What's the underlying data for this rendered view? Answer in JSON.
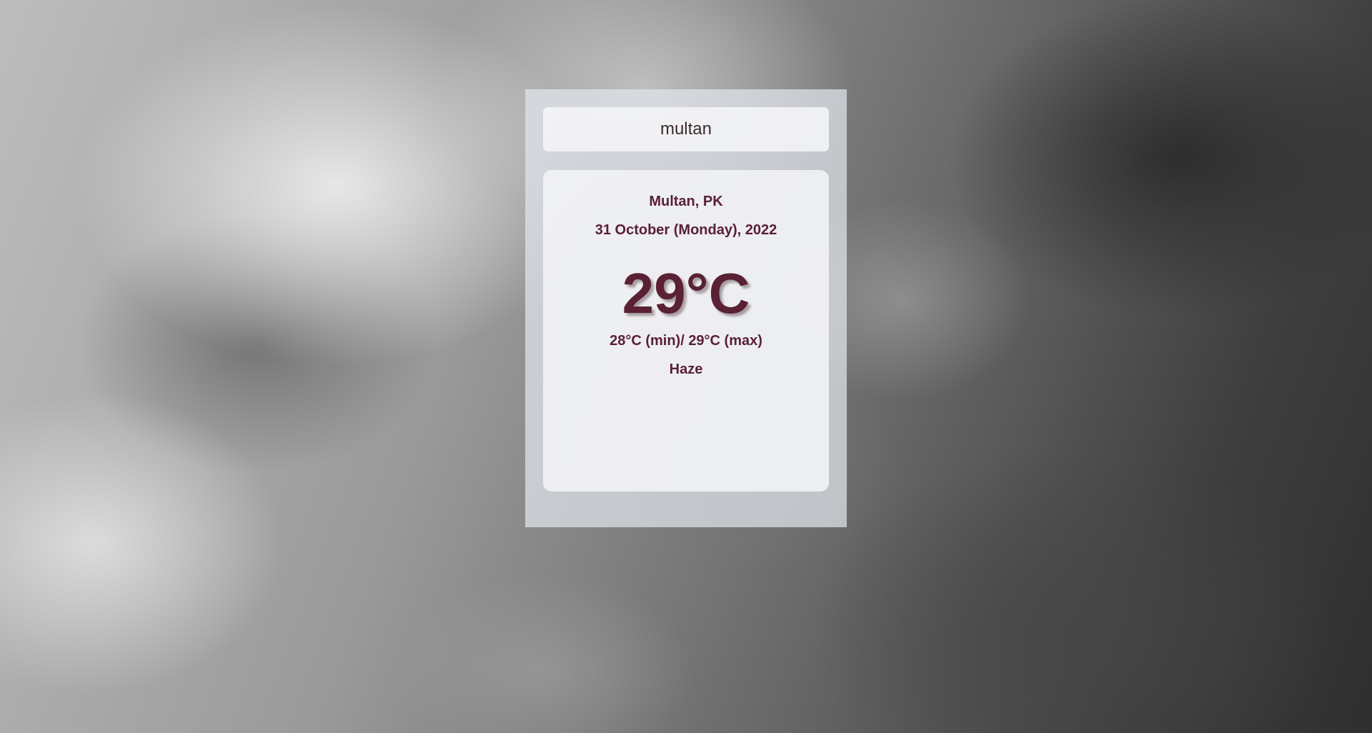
{
  "search": {
    "value": "multan"
  },
  "weather": {
    "location": "Multan, PK",
    "date": "31 October (Monday), 2022",
    "temperature": "29°C",
    "min_max": "28°C (min)/ 29°C (max)",
    "condition": "Haze"
  },
  "colors": {
    "text_accent": "#5a2034"
  }
}
